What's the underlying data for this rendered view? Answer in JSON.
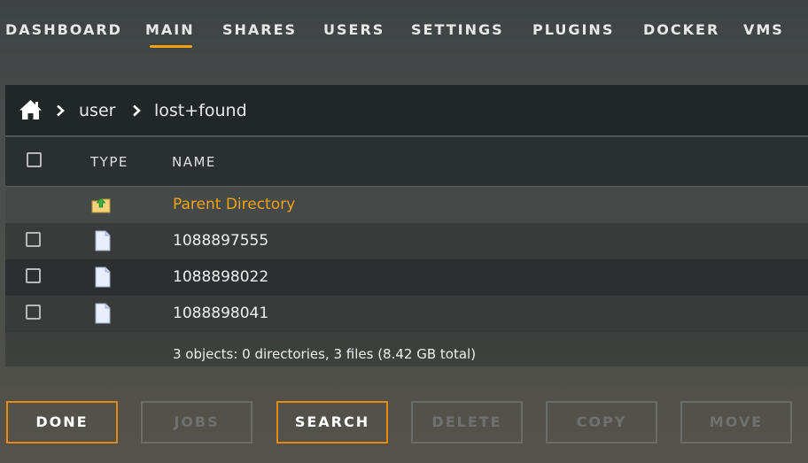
{
  "nav": {
    "items": [
      {
        "label": "DASHBOARD"
      },
      {
        "label": "MAIN"
      },
      {
        "label": "SHARES"
      },
      {
        "label": "USERS"
      },
      {
        "label": "SETTINGS"
      },
      {
        "label": "PLUGINS"
      },
      {
        "label": "DOCKER"
      },
      {
        "label": "VMS"
      }
    ],
    "active": "MAIN"
  },
  "breadcrumb": {
    "home_icon": "home-icon",
    "items": [
      "user",
      "lost+found"
    ]
  },
  "table": {
    "headers": {
      "type": "TYPE",
      "name": "NAME"
    },
    "parent": {
      "name": "Parent Directory",
      "icon": "folder-up-icon"
    },
    "rows": [
      {
        "name": "1088897555",
        "icon": "file-icon"
      },
      {
        "name": "1088898022",
        "icon": "file-icon"
      },
      {
        "name": "1088898041",
        "icon": "file-icon"
      }
    ],
    "summary": "3 objects: 0 directories, 3 files (8.42 GB total)"
  },
  "buttons": {
    "done": "DONE",
    "jobs": "JOBS",
    "search": "SEARCH",
    "delete": "DELETE",
    "copy": "COPY",
    "move": "MOVE"
  },
  "colors": {
    "accent": "#f0a30a",
    "button_active_border": "#e8890a"
  }
}
